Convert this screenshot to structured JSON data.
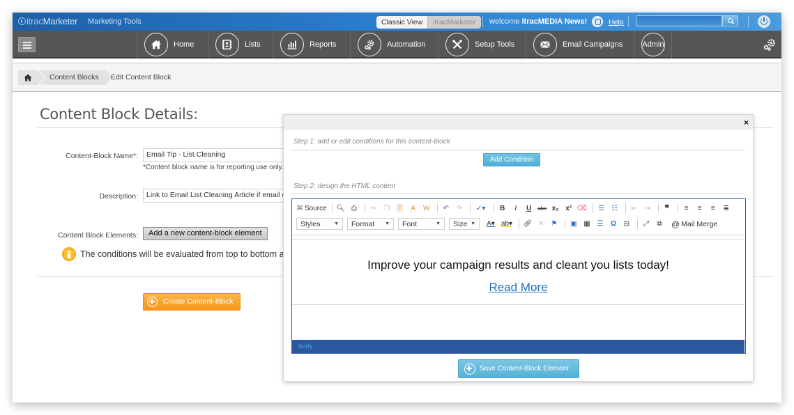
{
  "app": {
    "logo_prefix": "itrac",
    "logo_suffix": "Marketer",
    "section": "Marketing Tools"
  },
  "topbar": {
    "view_toggle": [
      "Classic View",
      "itracMarketer"
    ],
    "active_view": "Classic View",
    "welcome_prefix": "welcome ",
    "welcome_user": "itracMEDIA News!",
    "help_label": "Help",
    "search_placeholder": ""
  },
  "nav": {
    "items": [
      {
        "label": "Home",
        "icon": "home-icon"
      },
      {
        "label": "Lists",
        "icon": "address-book-icon"
      },
      {
        "label": "Reports",
        "icon": "bar-chart-icon"
      },
      {
        "label": "Automation",
        "icon": "gears-icon"
      },
      {
        "label": "Setup Tools",
        "icon": "tools-icon"
      },
      {
        "label": "Email Campaigns",
        "icon": "envelope-icon"
      },
      {
        "label": "Admin",
        "icon": ""
      }
    ]
  },
  "breadcrumb": {
    "items": [
      "Content Blocks",
      "Edit Content Block"
    ]
  },
  "page": {
    "title": "Content Block Details:",
    "name_label": "Content-Block Name*:",
    "name_value": "Email Tip - List Cleaning",
    "name_hint": "*Content block name is for reporting use only.",
    "description_label": "Description:",
    "description_value": "Link to Email List Cleaning Article if email cu",
    "elements_label": "Content Block Elements:",
    "add_element_button": "Add a new content-block element",
    "info_text": "The conditions will be evaluated from top to bottom a",
    "create_button": "Create Content-Block"
  },
  "modal": {
    "close": "×",
    "step1": "Step 1: add or edit conditions for this content-block",
    "add_condition_button": "Add Condition",
    "step2": "Step 2: design the HTML content",
    "toolbar": {
      "source_label": "Source",
      "combos": [
        "Styles",
        "Format",
        "Font",
        "Size"
      ],
      "mail_merge_label": "Mail Merge"
    },
    "content": {
      "headline": "Improve your campaign results and cleant you lists today!",
      "link": "Read More"
    },
    "status_path": "body",
    "save_button": "Save Content-Block Element"
  },
  "colors": {
    "topbar_blue": "#2a7ccc",
    "navbar_gray": "#565656",
    "orange_button": "#f5961c",
    "teal_button": "#55b2d8",
    "editor_border": "#2d5aa0",
    "link_blue": "#1f6fc0"
  }
}
